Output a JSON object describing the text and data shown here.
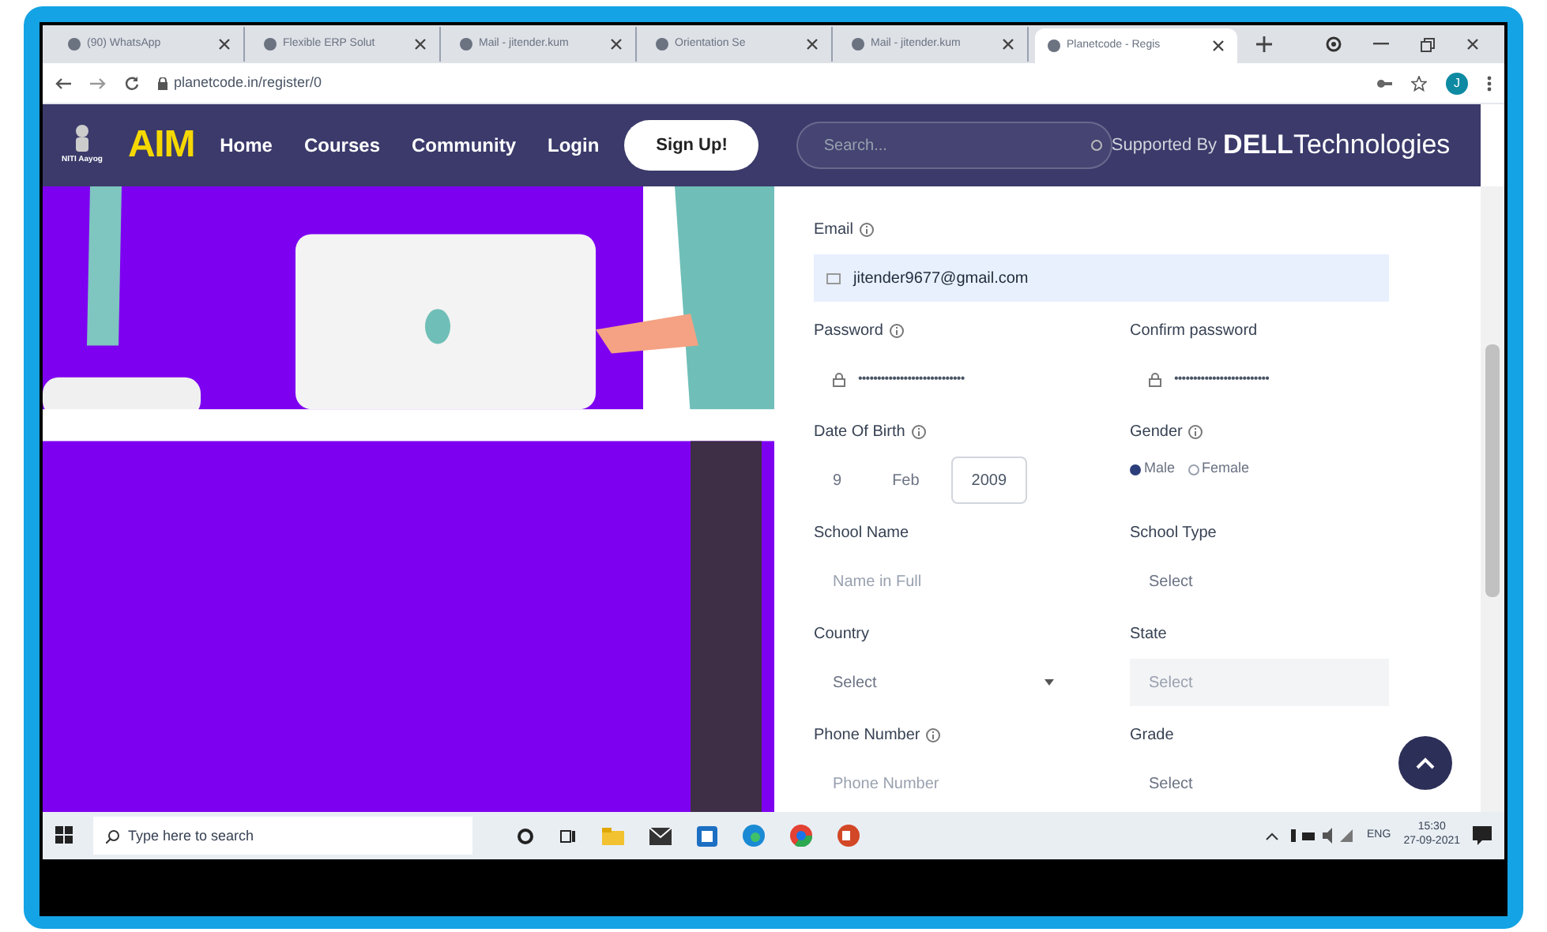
{
  "browser": {
    "tabs": [
      {
        "title": "(90) WhatsApp",
        "selected": false
      },
      {
        "title": "Flexible ERP Solut",
        "selected": false
      },
      {
        "title": "Mail - jitender.kum",
        "selected": false
      },
      {
        "title": "Orientation Se",
        "selected": false
      },
      {
        "title": "Mail - jitender.kum",
        "selected": false
      },
      {
        "title": "Planetcode - Regis",
        "selected": true
      }
    ],
    "url": "planetcode.in/register/0",
    "profile_initial": "J"
  },
  "nav": {
    "emblem_caption": "NITI Aayog",
    "logo": "AIM",
    "links": [
      "Home",
      "Courses",
      "Community",
      "Login"
    ],
    "signup": "Sign Up!",
    "search_placeholder": "Search...",
    "supported_by": "Supported By",
    "sponsor_bold": "DELL",
    "sponsor_light": "Technologies"
  },
  "form": {
    "fields": [
      {
        "kind": "email",
        "label": "Email",
        "info": true,
        "value": "jitender9677@gmail.com"
      },
      {
        "kind": "password",
        "label": "Password",
        "info": true,
        "value": "••••••••••••••••••••••••••••"
      },
      {
        "kind": "password",
        "label": "Confirm password",
        "value": "•••••••••••••••••••••••••"
      },
      {
        "kind": "date",
        "label": "Date Of Birth",
        "info": true,
        "parts": [
          {
            "text": "9",
            "focused": false
          },
          {
            "text": "Feb",
            "focused": false
          },
          {
            "text": "2009",
            "focused": true
          }
        ]
      },
      {
        "kind": "radio",
        "label": "Gender",
        "info": true,
        "options": [
          {
            "label": "Male",
            "selected": true
          },
          {
            "label": "Female",
            "selected": false
          }
        ]
      },
      {
        "kind": "text",
        "label": "School Name",
        "placeholder": "Name in Full"
      },
      {
        "kind": "select",
        "label": "School Type",
        "placeholder": "Select",
        "disabled": false
      },
      {
        "kind": "select",
        "label": "Country",
        "placeholder": "Select",
        "disabled": false,
        "caret": true
      },
      {
        "kind": "select",
        "label": "State",
        "placeholder": "Select",
        "disabled": true
      },
      {
        "kind": "text",
        "label": "Phone Number",
        "info": true,
        "placeholder": "Phone Number"
      },
      {
        "kind": "select",
        "label": "Grade",
        "placeholder": "Select",
        "disabled": false
      }
    ]
  },
  "taskbar": {
    "search_placeholder": "Type here to search",
    "language": "ENG",
    "time": "15:30",
    "date": "27-09-2021"
  }
}
